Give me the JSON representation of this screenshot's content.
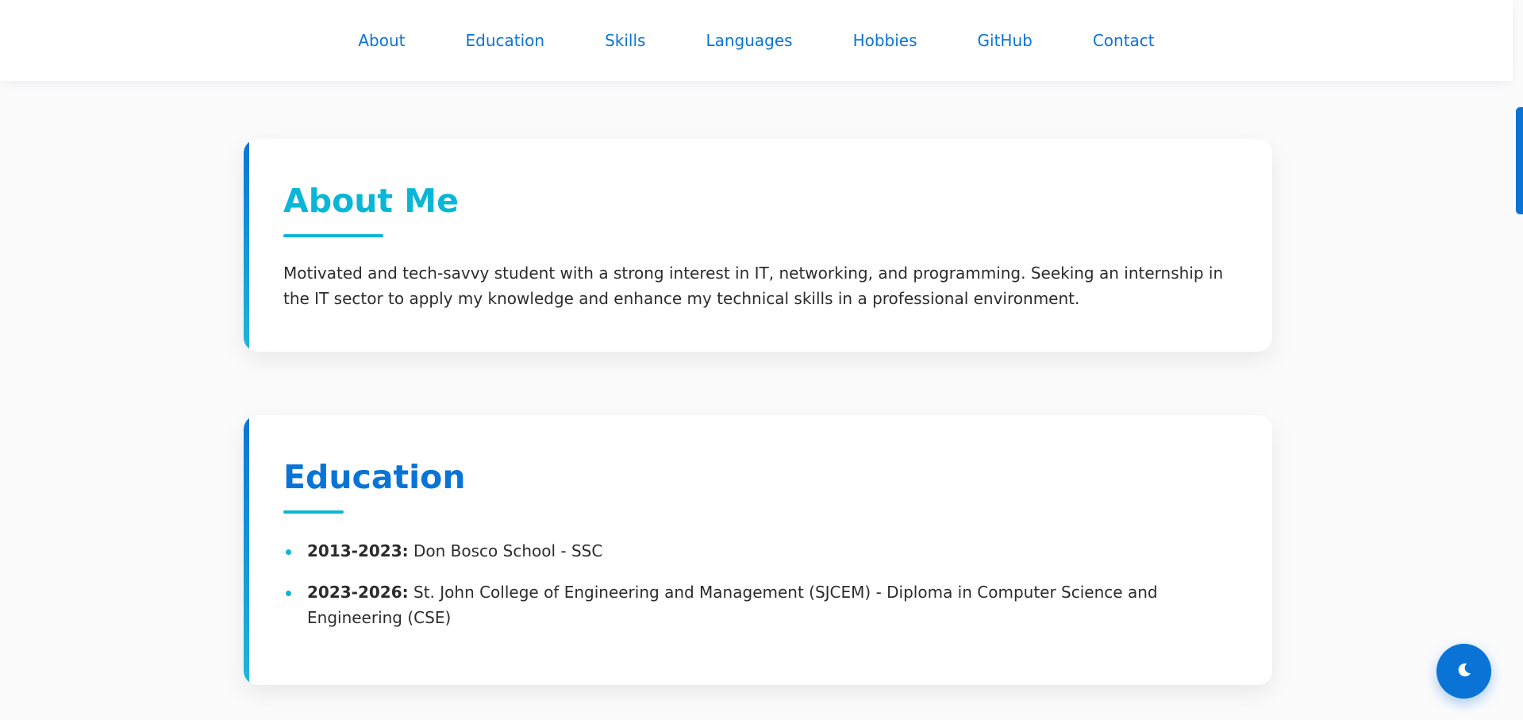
{
  "nav": {
    "items": [
      {
        "label": "About"
      },
      {
        "label": "Education"
      },
      {
        "label": "Skills"
      },
      {
        "label": "Languages"
      },
      {
        "label": "Hobbies"
      },
      {
        "label": "GitHub"
      },
      {
        "label": "Contact"
      }
    ]
  },
  "about": {
    "title": "About Me",
    "text": "Motivated and tech-savvy student with a strong interest in IT, networking, and programming. Seeking an internship in the IT sector to apply my knowledge and enhance my technical skills in a professional environment."
  },
  "education": {
    "title": "Education",
    "items": [
      {
        "years": "2013-2023:",
        "detail": "Don Bosco School - SSC"
      },
      {
        "years": "2023-2026:",
        "detail": "St. John College of Engineering and Management (SJCEM) - Diploma in Computer Science and Engineering (CSE)"
      }
    ]
  },
  "theme_toggle": {
    "icon": "moon-icon"
  },
  "colors": {
    "accent": "#0a74d6",
    "accent_secondary": "#0ab6d6"
  }
}
